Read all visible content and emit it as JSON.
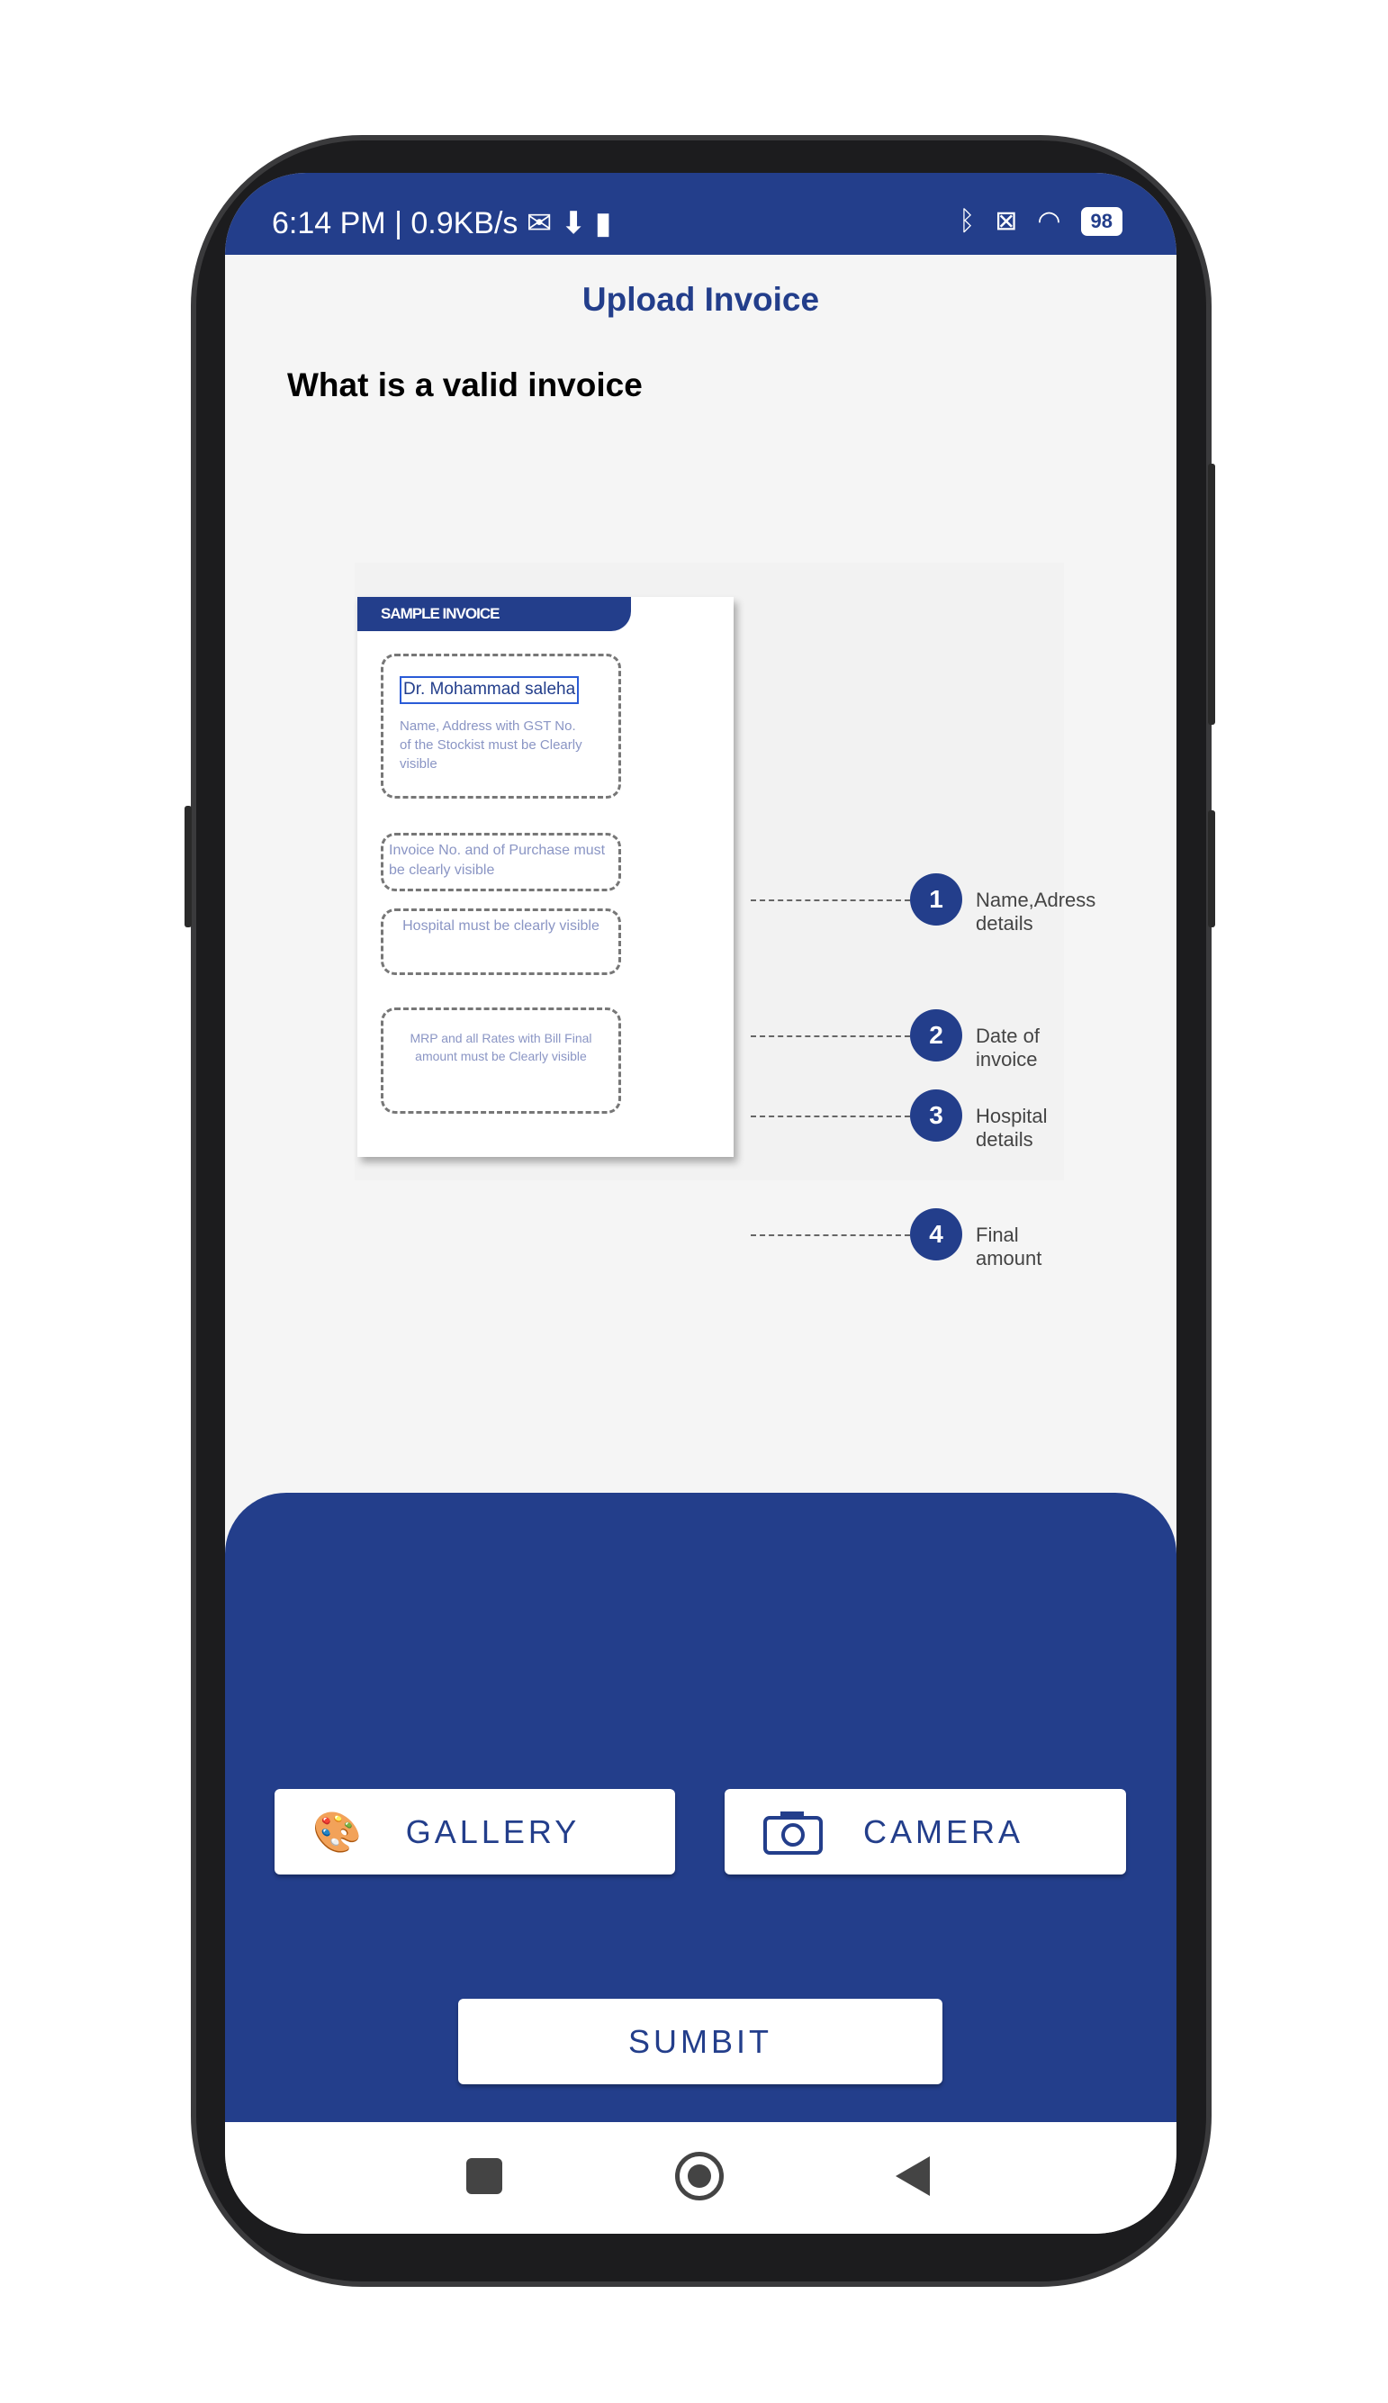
{
  "status_bar": {
    "left": "6:14 PM | 0.9KB/s",
    "battery": "98",
    "icons": [
      "gmail-icon",
      "download-icon",
      "notification-icon",
      "bluetooth-icon",
      "no-sim-icon",
      "wifi-icon",
      "battery-icon"
    ]
  },
  "header": {
    "title": "Upload Invoice"
  },
  "main": {
    "heading": "What is a valid invoice",
    "sample": {
      "card_title": "SAMPLE INVOICE",
      "doctor": "Dr. Mohammad saleha",
      "box1": "Name, Address with GST No. of the Stockist must be Clearly visible",
      "box2": "Invoice No. and of Purchase must be clearly visible",
      "box3": "Hospital must be clearly visible",
      "box4": "MRP and all Rates with Bill Final amount must be Clearly visible",
      "callouts": [
        {
          "n": "1",
          "label": "Name,Adress details"
        },
        {
          "n": "2",
          "label": "Date of invoice"
        },
        {
          "n": "3",
          "label": "Hospital details"
        },
        {
          "n": "4",
          "label": "Final amount"
        }
      ]
    }
  },
  "actions": {
    "gallery": "GALLERY",
    "camera": "CAMERA",
    "submit": "SUMBIT"
  },
  "colors": {
    "brand": "#233e8b"
  }
}
